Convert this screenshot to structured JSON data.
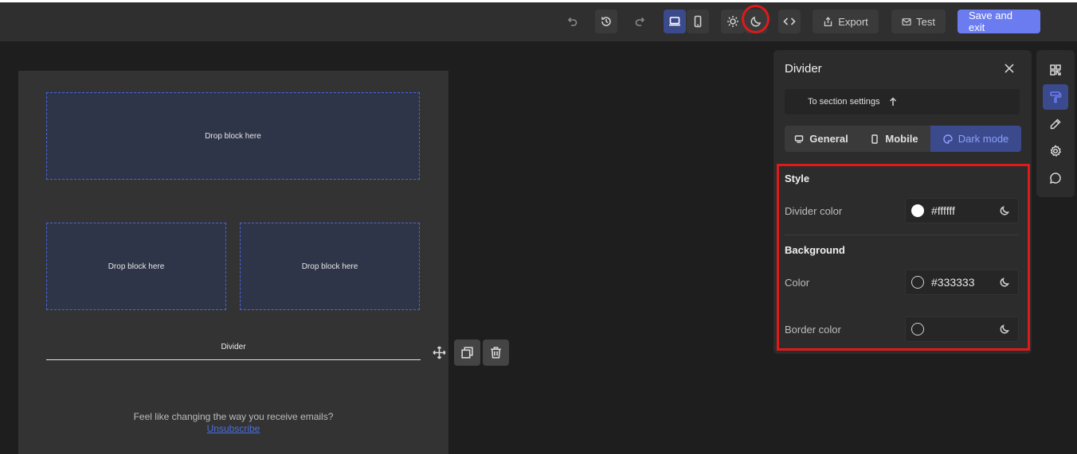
{
  "toolbar": {
    "undo_icon": "undo-icon",
    "history_icon": "history-icon",
    "redo_icon": "redo-icon",
    "desktop_icon": "desktop-icon",
    "mobile_icon": "mobile-icon",
    "light_icon": "sun-icon",
    "dark_icon": "moon-icon",
    "code_icon": "code-icon",
    "export_label": "Export",
    "test_label": "Test",
    "save_label": "Save and exit"
  },
  "canvas": {
    "drop_blocks": [
      "Drop block here",
      "Drop block here",
      "Drop block here"
    ],
    "divider_label": "Divider",
    "footer_text": "Feel like changing the way you receive emails?",
    "unsubscribe_label": "Unsubscribe"
  },
  "panel": {
    "title": "Divider",
    "section_settings_label": "To section settings",
    "tabs": [
      {
        "label": "General",
        "icon": "desktop-icon"
      },
      {
        "label": "Mobile",
        "icon": "mobile-icon"
      },
      {
        "label": "Dark mode",
        "icon": "palette-icon"
      }
    ],
    "style_heading": "Style",
    "divider_color_label": "Divider color",
    "divider_color_value": "#ffffff",
    "background_heading": "Background",
    "color_label": "Color",
    "color_value": "#333333",
    "border_color_label": "Border color",
    "border_color_value": ""
  },
  "colors": {
    "accent": "#6b7cf0",
    "selected_bg": "#3b4a8c",
    "highlight_red": "#e11919",
    "canvas_bg": "#333333",
    "app_bg": "#1e1e1e"
  }
}
